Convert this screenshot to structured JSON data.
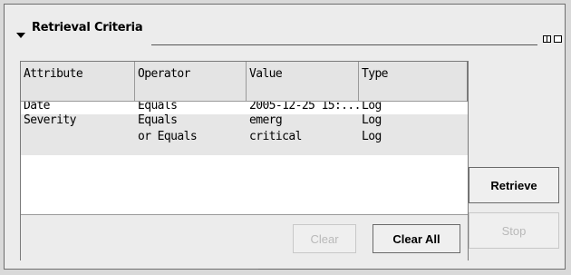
{
  "panel": {
    "title": "Retrieval Criteria"
  },
  "table": {
    "columns": [
      "Attribute",
      "Operator",
      "Value",
      "Type"
    ],
    "rows": [
      {
        "attribute": "Date",
        "operator": "Equals",
        "value": "2005-12-25 15:...",
        "type": "Log"
      },
      {
        "attribute": "Severity",
        "operator": "Equals",
        "value": "emerg",
        "type": "Log"
      },
      {
        "attribute": "",
        "operator": "or Equals",
        "value": "critical",
        "type": "Log"
      }
    ]
  },
  "buttons": {
    "clear": "Clear",
    "clear_all": "Clear All",
    "retrieve": "Retrieve",
    "stop": "Stop"
  },
  "icons": {
    "collapse": "triangle-down-icon",
    "window_a": "split-view-icon",
    "window_b": "single-view-icon"
  },
  "colors": {
    "panel_bg": "#ececec",
    "table_body_bg": "#ffffff",
    "alt_row_bg": "#e6e6e6",
    "disabled_text": "#b9b9b9"
  }
}
